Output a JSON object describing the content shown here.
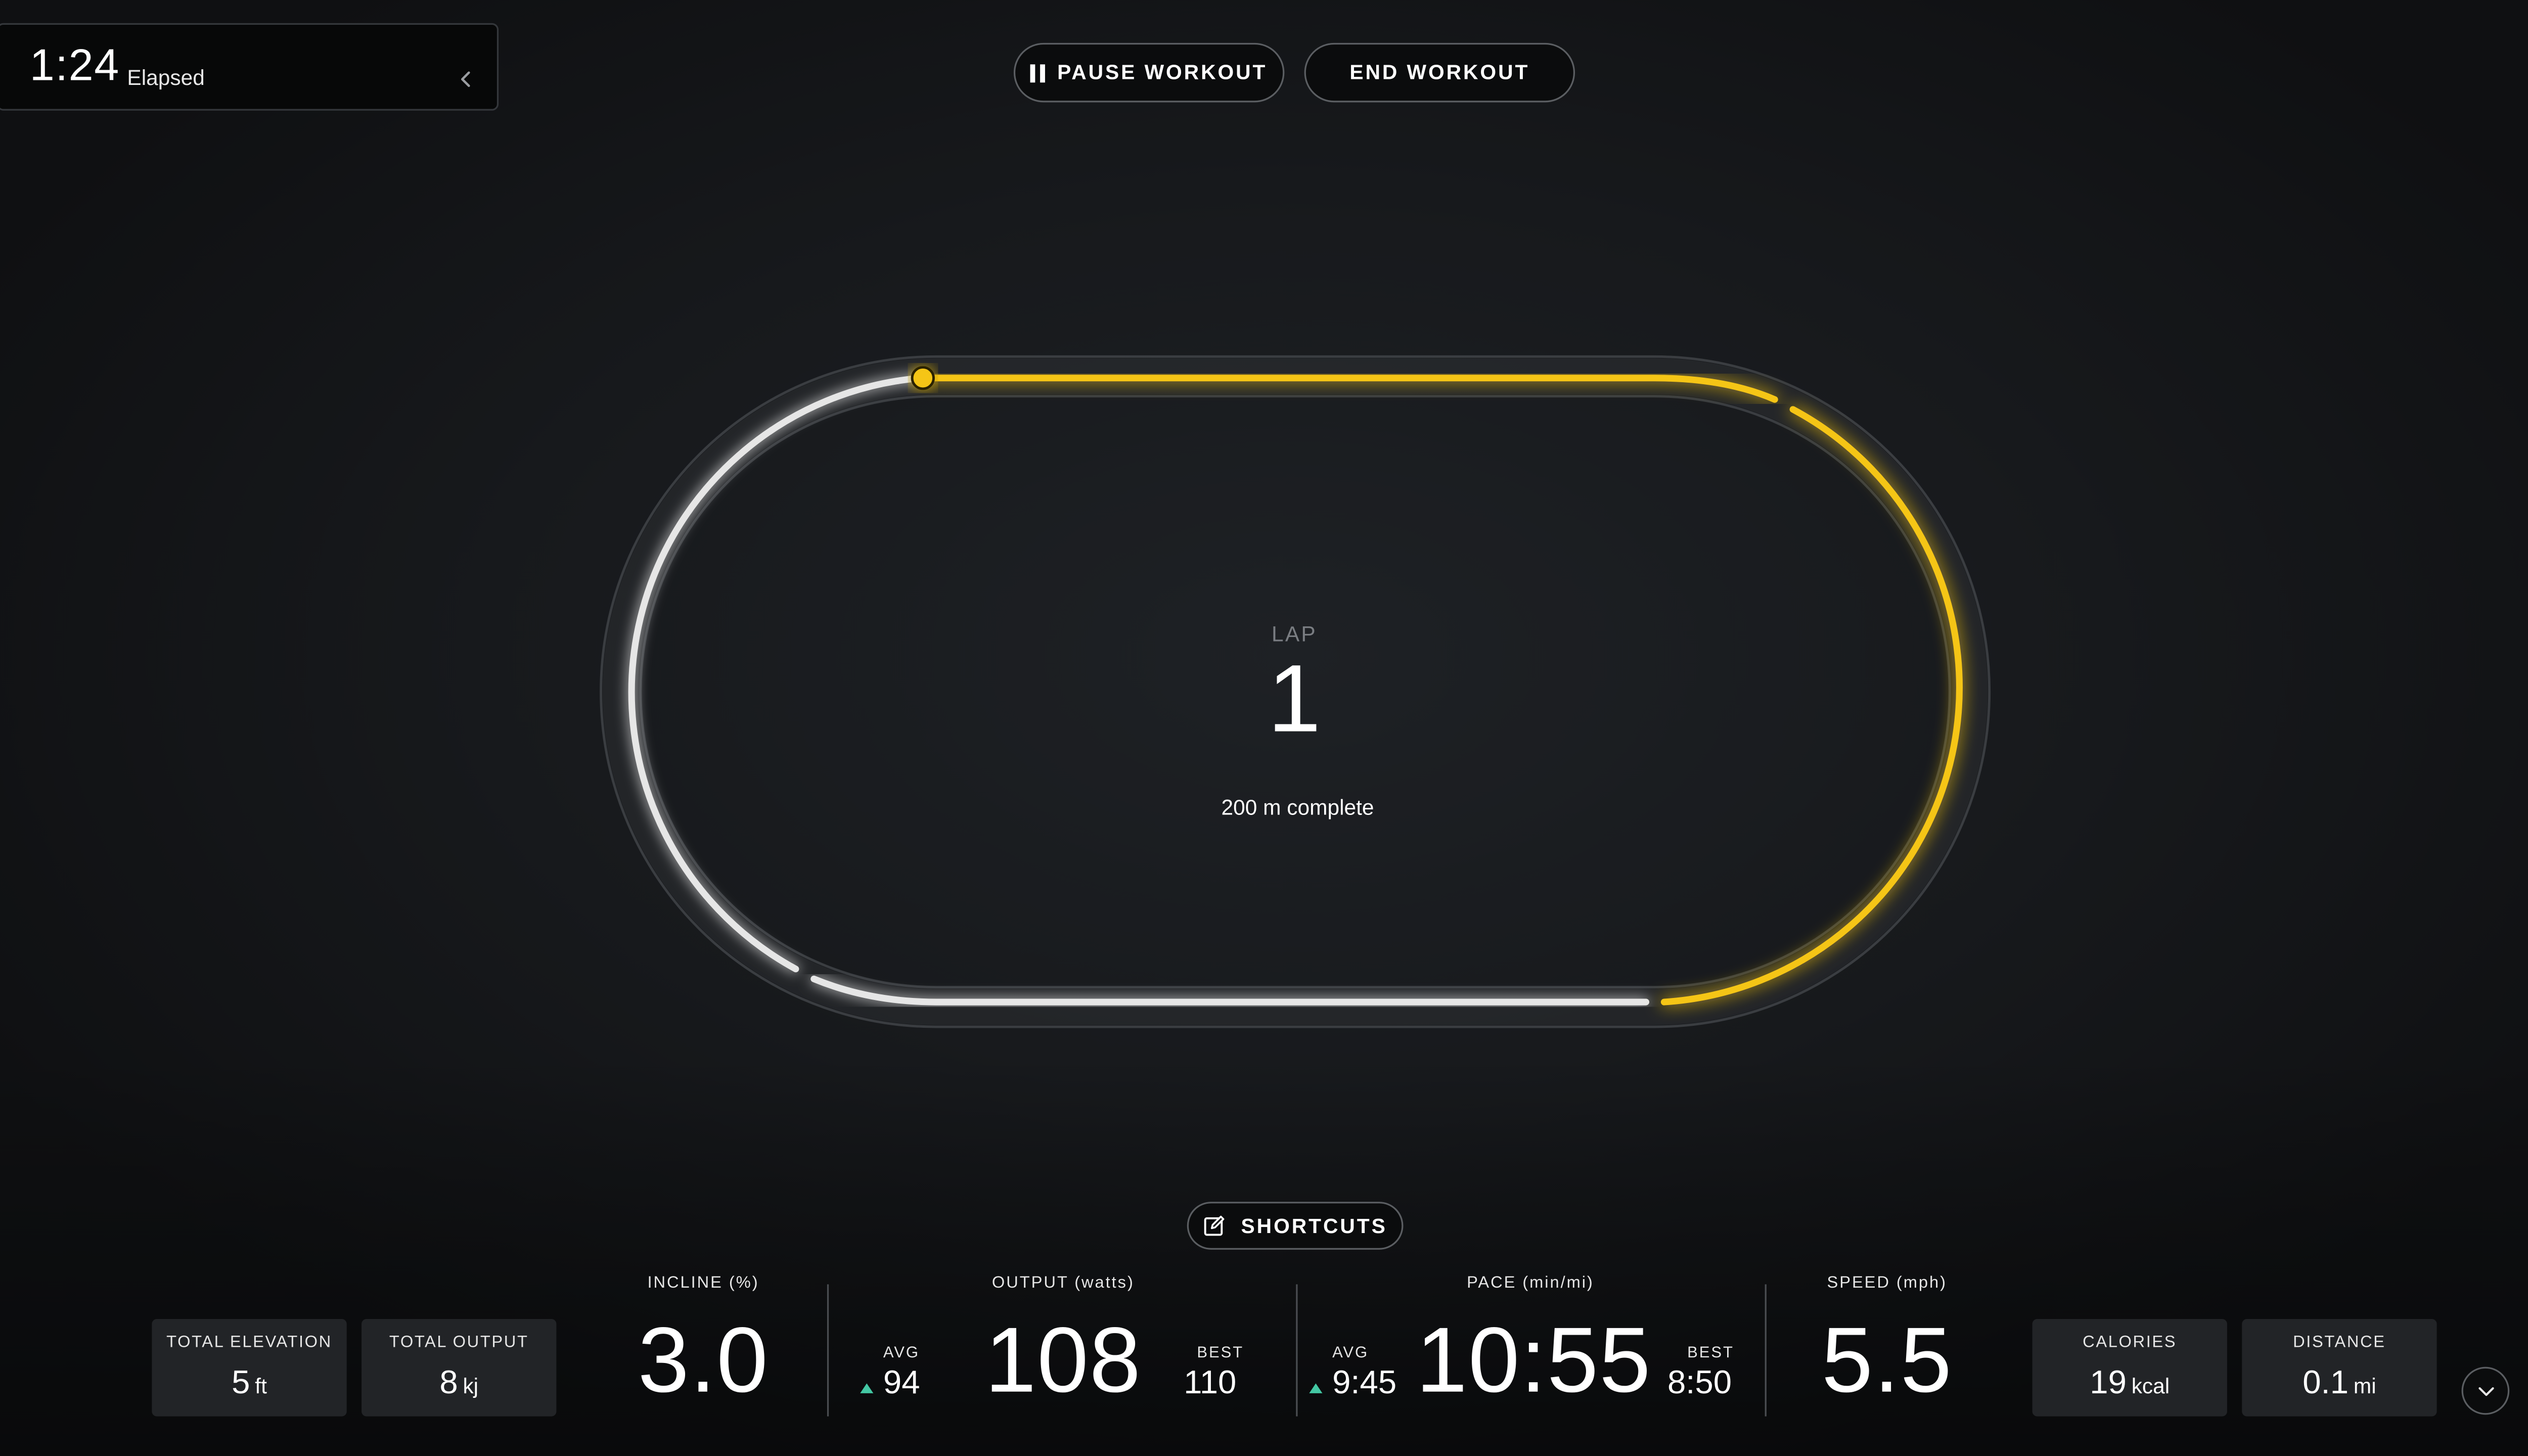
{
  "elapsed": {
    "time": "1:24",
    "label": "Elapsed",
    "collapse_icon": "chevron-left-icon"
  },
  "controls": {
    "pause_label": "PAUSE WORKOUT",
    "end_label": "END WORKOUT",
    "pause_icon": "pause-icon"
  },
  "lap": {
    "caption": "LAP",
    "number": "1",
    "complete_text": "200 m complete",
    "progress_fraction": 0.5,
    "accent_color": "#f5c518",
    "track_color": "#e6e6e6"
  },
  "shortcuts": {
    "label": "SHORTCUTS",
    "icon": "edit-icon"
  },
  "tiles": {
    "total_elevation": {
      "label": "TOTAL ELEVATION",
      "value": "5",
      "unit": "ft"
    },
    "total_output": {
      "label": "TOTAL OUTPUT",
      "value": "8",
      "unit": "kj"
    },
    "calories": {
      "label": "CALORIES",
      "value": "19",
      "unit": "kcal"
    },
    "distance": {
      "label": "DISTANCE",
      "value": "0.1",
      "unit": "mi"
    }
  },
  "stats": {
    "incline": {
      "label": "INCLINE (%)",
      "value": "3.0"
    },
    "output": {
      "label": "OUTPUT (watts)",
      "value": "108",
      "avg_label": "AVG",
      "avg": "94",
      "best_label": "BEST",
      "best": "110"
    },
    "pace": {
      "label": "PACE (min/mi)",
      "value": "10:55",
      "avg_label": "AVG",
      "avg": "9:45",
      "best_label": "BEST",
      "best": "8:50"
    },
    "speed": {
      "label": "SPEED (mph)",
      "value": "5.5"
    }
  },
  "colors": {
    "avg_up_arrow": "#43c7a3"
  },
  "expand_icon": "chevron-down-icon"
}
